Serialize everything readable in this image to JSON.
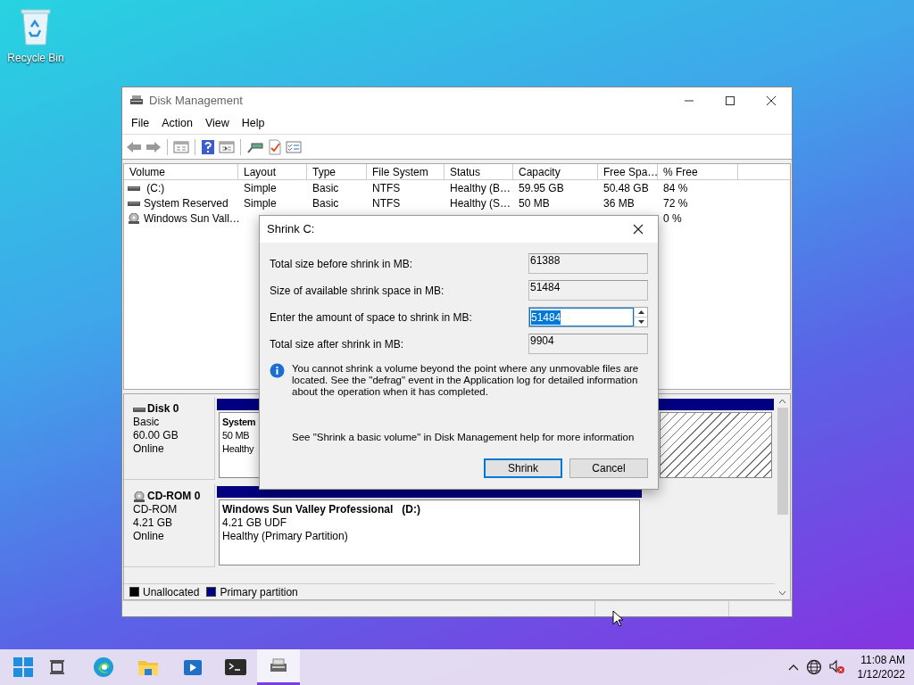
{
  "desktop_icons": [
    {
      "label": "Recycle Bin"
    }
  ],
  "window": {
    "title": "Disk Management",
    "menu": [
      "File",
      "Action",
      "View",
      "Help"
    ],
    "volume_list": {
      "columns": [
        "Volume",
        "Layout",
        "Type",
        "File System",
        "Status",
        "Capacity",
        "Free Spa…",
        "% Free"
      ],
      "rows": [
        {
          "volume": " (C:)",
          "layout": "Simple",
          "type": "Basic",
          "file_system": "NTFS",
          "status": "Healthy (B…",
          "capacity": "59.95 GB",
          "free_space": "50.48 GB",
          "pct_free": "84 %",
          "kind": "hdd"
        },
        {
          "volume": "System Reserved",
          "layout": "Simple",
          "type": "Basic",
          "file_system": "NTFS",
          "status": "Healthy (S…",
          "capacity": "50 MB",
          "free_space": "36 MB",
          "pct_free": "72 %",
          "kind": "hdd"
        },
        {
          "volume": "Windows Sun Vall…",
          "pct_free": "0 %",
          "kind": "cd"
        }
      ]
    },
    "disks": [
      {
        "kind": "hdd",
        "name": "Disk 0",
        "type": "Basic",
        "size": "60.00 GB",
        "status": "Online",
        "partitions": [
          {
            "kind": "primary",
            "title": "System",
            "lines": [
              "50 MB",
              "Healthy"
            ]
          },
          {
            "kind": "unallocated"
          }
        ]
      },
      {
        "kind": "cd",
        "name": "CD-ROM 0",
        "type": "CD-ROM",
        "size": "4.21 GB",
        "status": "Online",
        "partitions": [
          {
            "kind": "primary",
            "title": "Windows Sun Valley Professional   (D:)",
            "lines": [
              "4.21 GB UDF",
              "Healthy (Primary Partition)"
            ]
          }
        ]
      }
    ],
    "legend": [
      {
        "label": "Unallocated",
        "color": "#000000"
      },
      {
        "label": "Primary partition",
        "color": "#000080"
      }
    ]
  },
  "dialog": {
    "title": "Shrink C:",
    "fields": [
      {
        "label": "Total size before shrink in MB:",
        "value": "61388",
        "kind": "readonly"
      },
      {
        "label": "Size of available shrink space in MB:",
        "value": "51484",
        "kind": "readonly"
      },
      {
        "label": "Enter the amount of space to shrink in MB:",
        "value": "51484",
        "kind": "spin"
      },
      {
        "label": "Total size after shrink in MB:",
        "value": "9904",
        "kind": "readonly"
      }
    ],
    "info": "You cannot shrink a volume beyond the point where any unmovable files are located. See the \"defrag\" event in the Application log for detailed information about the operation when it has completed.",
    "help": "See \"Shrink a basic volume\" in Disk Management help for more information",
    "buttons": [
      {
        "label": "Shrink",
        "default": true
      },
      {
        "label": "Cancel",
        "default": false
      }
    ]
  },
  "taskbar": {
    "apps": [
      {
        "kind": "start",
        "selected": false
      },
      {
        "kind": "taskview",
        "selected": false
      },
      {
        "kind": "edge",
        "selected": false
      },
      {
        "kind": "explorer",
        "selected": false
      },
      {
        "kind": "store",
        "selected": false
      },
      {
        "kind": "terminal",
        "selected": false
      },
      {
        "kind": "diskmgmt",
        "selected": true
      }
    ],
    "time": "11:08 AM",
    "date": "1/12/2022"
  }
}
